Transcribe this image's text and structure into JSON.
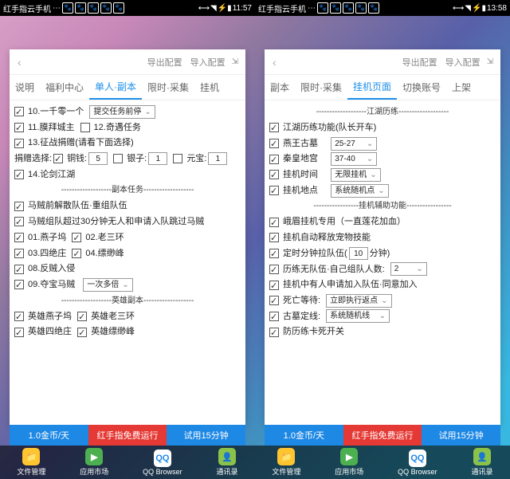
{
  "left": {
    "status": {
      "app": "红手指云手机",
      "time": "11:57"
    },
    "header": {
      "export": "导出配置",
      "import": "导入配置"
    },
    "tabs": [
      "说明",
      "福利中心",
      "单人·副本",
      "限时·采集",
      "挂机"
    ],
    "activeTab": 2,
    "items": {
      "c10": "10.一千零一个",
      "c10sel": "提交任务前停",
      "c11": "11.膜拜城主",
      "c12": "12.奇遇任务",
      "c13": "13.征战捐赠(请看下面选择)",
      "donLab": "捐赠选择:",
      "bronze": "铜钱:",
      "bronzeV": "5",
      "silver": "银子:",
      "silverV": "1",
      "gold": "元宝:",
      "goldV": "1",
      "c14": "14.论剑江湖",
      "div1": "副本任务",
      "m1": "马贼前解散队伍·重组队伍",
      "m2": "马贼组队超过30分钟无人和申请入队跳过马贼",
      "s01": "01.燕子坞",
      "s02": "02.老三环",
      "s03": "03.四绝庄",
      "s04": "04.缥缈峰",
      "s08": "08.反贼入侵",
      "s09": "09.夺宝马贼",
      "s09sel": "一次多倍",
      "div2": "英雄副本",
      "h1": "英雄燕子坞",
      "h2": "英雄老三环",
      "h3": "英雄四绝庄",
      "h4": "英雄缥缈峰"
    },
    "bottom": {
      "b1": "1.0金币/天",
      "b2": "红手指免费运行",
      "b3": "试用15分钟"
    },
    "dock": [
      "文件管理",
      "应用市场",
      "QQ Browser",
      "通讯录"
    ]
  },
  "right": {
    "status": {
      "app": "红手指云手机",
      "time": "13:58"
    },
    "header": {
      "export": "导出配置",
      "import": "导入配置"
    },
    "tabs": [
      "副本",
      "限时·采集",
      "挂机页面",
      "切换账号",
      "上架"
    ],
    "activeTab": 2,
    "items": {
      "div1": "江湖历练",
      "r1": "江湖历练功能(队长开车)",
      "r2": "燕王古墓",
      "r2sel": "25-27",
      "r3": "秦皇地宫",
      "r3sel": "37-40",
      "r4": "挂机时间",
      "r4sel": "无限挂机",
      "r5": "挂机地点",
      "r5sel": "系统随机点",
      "div2": "挂机辅助功能",
      "r6": "峨眉挂机专用（一直莲花加血）",
      "r7": "挂机自动释放宠物技能",
      "r8a": "定时分钟拉队伍(",
      "r8b": "10",
      "r8c": "分钟)",
      "r9a": "历练无队伍·自己组队人数:",
      "r9sel": "2",
      "r10": "挂机中有人申请加入队伍·同意加入",
      "r11": "死亡等待:",
      "r11sel": "立即执行返点",
      "r12": "古墓定线:",
      "r12sel": "系统随机线",
      "r13": "防历练卡死开关"
    },
    "bottom": {
      "b1": "1.0金币/天",
      "b2": "红手指免费运行",
      "b3": "试用15分钟"
    },
    "dock": [
      "文件管理",
      "应用市场",
      "QQ Browser",
      "通讯录"
    ]
  }
}
